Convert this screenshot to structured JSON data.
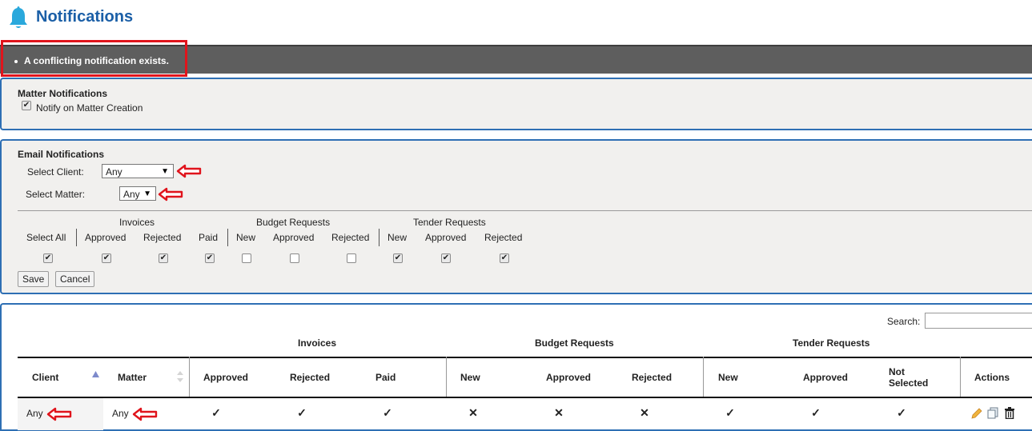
{
  "header": {
    "title": "Notifications",
    "icon": "bell-icon"
  },
  "alert": {
    "message": "A conflicting notification exists."
  },
  "matter_notifications": {
    "heading": "Matter Notifications",
    "notify_label": "Notify on Matter Creation",
    "notify_checked": true
  },
  "email_notifications": {
    "heading": "Email Notifications",
    "select_client_label": "Select Client:",
    "select_client_value": "Any",
    "select_matter_label": "Select Matter:",
    "select_matter_value": "Any",
    "groups": {
      "invoices": "Invoices",
      "budget": "Budget Requests",
      "tender": "Tender Requests"
    },
    "columns": {
      "select_all": "Select All",
      "inv_approved": "Approved",
      "inv_rejected": "Rejected",
      "inv_paid": "Paid",
      "bud_new": "New",
      "bud_approved": "Approved",
      "bud_rejected": "Rejected",
      "ten_new": "New",
      "ten_approved": "Approved",
      "ten_rejected": "Rejected"
    },
    "checked": [
      true,
      true,
      true,
      true,
      false,
      false,
      false,
      true,
      true,
      true
    ],
    "save_label": "Save",
    "cancel_label": "Cancel"
  },
  "table": {
    "search_label": "Search:",
    "search_value": "",
    "groups": {
      "invoices": "Invoices",
      "budget": "Budget Requests",
      "tender": "Tender Requests"
    },
    "headers": {
      "client": "Client",
      "matter": "Matter",
      "inv_approved": "Approved",
      "inv_rejected": "Rejected",
      "inv_paid": "Paid",
      "bud_new": "New",
      "bud_approved": "Approved",
      "bud_rejected": "Rejected",
      "ten_new": "New",
      "ten_approved": "Approved",
      "ten_not_selected": "Not Selected",
      "actions": "Actions"
    },
    "row": {
      "client": "Any",
      "matter": "Any",
      "marks": [
        "✓",
        "✓",
        "✓",
        "✕",
        "✕",
        "✕",
        "✓",
        "✓",
        "✓"
      ]
    }
  },
  "colors": {
    "accent": "#2e6fb4",
    "title": "#1b5fa7",
    "alert_bg": "#5e5e5e",
    "highlight": "#e0141c"
  }
}
